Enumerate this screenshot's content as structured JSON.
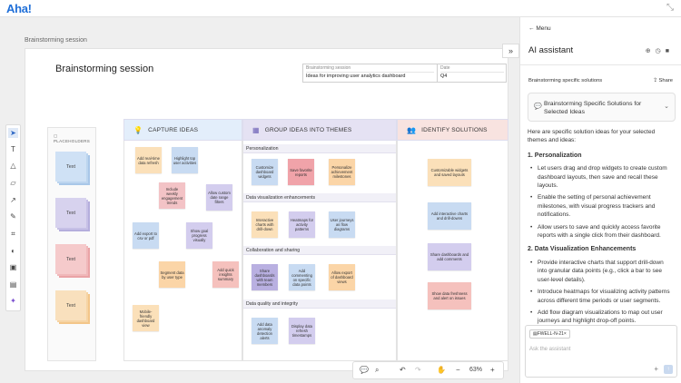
{
  "app": {
    "logo": "Aha!"
  },
  "canvas": {
    "title": "Brainstorming session"
  },
  "board": {
    "title": "Brainstorming session",
    "meta": {
      "label1": "Brainstorming session",
      "value1": "Ideas for improving user analytics dashboard",
      "label2": "Date",
      "value2": "Q4"
    },
    "placeholders": {
      "label": "PLACEHOLDERS",
      "items": [
        "Text",
        "Text",
        "Text",
        "Text"
      ]
    },
    "columns": [
      {
        "title": "CAPTURE IDEAS",
        "icon": "lightbulb-icon"
      },
      {
        "title": "GROUP IDEAS INTO THEMES",
        "icon": "layers-icon"
      },
      {
        "title": "IDENTIFY SOLUTIONS",
        "icon": "people-icon"
      }
    ],
    "capture_notes": [
      "Add real-time data refresh",
      "Highlight top user activities",
      "Include weekly engagement trends",
      "Allow custom date range filters",
      "Add export to csv or pdf",
      "Show goal progress visually",
      "Segment data by user type",
      "Add quick insights summary",
      "Mobile-friendly dashboard view"
    ],
    "themes": [
      {
        "title": "Personalization",
        "notes": [
          "Customize dashboard widgets",
          "Save favorite reports",
          "Personalize achievement milestones"
        ]
      },
      {
        "title": "Data visualization enhancements",
        "notes": [
          "Interactive charts with drill-down",
          "Heatmaps for activity patterns",
          "User journeys as flow diagrams"
        ]
      },
      {
        "title": "Collaboration and sharing",
        "notes": [
          "Share dashboards with team members",
          "Add commenting on specific data points",
          "Allow export of dashboard views"
        ]
      },
      {
        "title": "Data quality and integrity",
        "notes": [
          "Add data anomaly detection alerts",
          "Display data refresh timestamps"
        ]
      }
    ],
    "solutions": [
      "Customizable widgets and saved layouts",
      "Add interactive charts and drill-downs",
      "Share dashboards and add comments",
      "Show data freshness and alert on issues"
    ]
  },
  "bottombar": {
    "zoom": "63%"
  },
  "panel": {
    "menu": "Menu",
    "title": "AI assistant",
    "chat_title": "Brainstorming specific solutions",
    "share": "Share",
    "prompt": "Brainstorming Specific Solutions for Selected Ideas",
    "intro": "Here are specific solution ideas for your selected themes and ideas:",
    "sections": [
      {
        "heading": "1. Personalization",
        "bullets": [
          "Let users drag and drop widgets to create custom dashboard layouts, then save and recall these layouts.",
          "Enable the setting of personal achievement milestones, with visual progress trackers and notifications.",
          "Allow users to save and quickly access favorite reports with a single click from their dashboard."
        ]
      },
      {
        "heading": "2. Data Visualization Enhancements",
        "bullets": [
          "Provide interactive charts that support drill-down into granular data points (e.g., click a bar to see user-level details).",
          "Introduce heatmaps for visualizing activity patterns across different time periods or user segments.",
          "Add flow diagram visualizations to map out user journeys and highlight drop-off points."
        ]
      }
    ],
    "chip": "FWELL-N-21",
    "input_placeholder": "Ask the assistant"
  }
}
